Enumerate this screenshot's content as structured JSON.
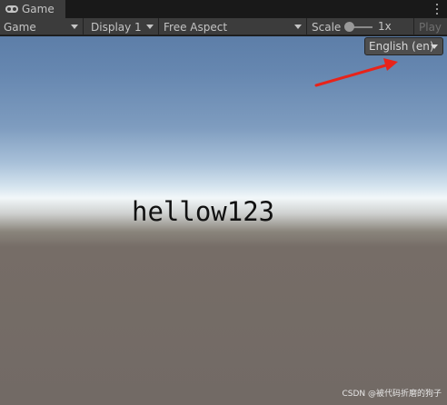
{
  "window": {
    "tab_title": "Game",
    "tab_icon": "gamepad-icon",
    "menu_icon": "kebab-menu-icon"
  },
  "toolbar": {
    "view_mode": "Game",
    "display": "Display 1",
    "aspect": "Free Aspect",
    "scale_label": "Scale",
    "scale_value": "1x",
    "play_label": "Play"
  },
  "game": {
    "language_dropdown": "English (en)",
    "hello_text": "hellow123",
    "annotation_arrow_color": "#e8231a"
  },
  "watermark": "CSDN @被代码折磨的狗子",
  "colors": {
    "toolbar_bg": "#3c3c3c",
    "tab_bg": "#3c3c3c",
    "sky_top": "#5d7ea8",
    "horizon": "#f2f7f9",
    "ground": "#726a65"
  }
}
